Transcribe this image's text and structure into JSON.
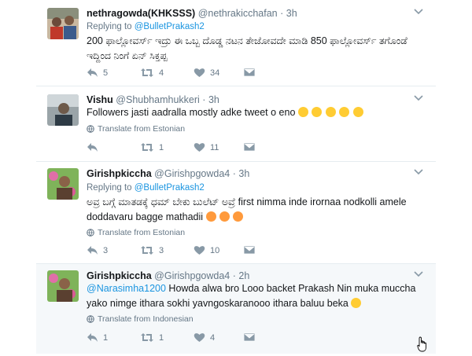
{
  "tweets": [
    {
      "name": "nethragowda(KHKSSS)",
      "handle": "@nethrakicchafan",
      "time": "3h",
      "reply_prefix": "Replying to",
      "reply_to": "@BulletPrakash2",
      "text_line1": "200 ಫಾಲ್ಲೋವರ್ಸ್ ಇದ್ರು ಈ ಒಬ್ಬ ದೊಡ್ಡ ನಟನ ತೇಜೋವದೇ ಮಾಡಿ 850 ಫಾಲ್ಲೋವರ್ಸ್ ತಗೊಂಡೆ",
      "text_line2": "ಇದ್ದಿಂದ ನಿಂಗೆ ಏನ್ ಸಿಕ್ತಪ್ಪ",
      "replies": "5",
      "retweets": "4",
      "likes": "34"
    },
    {
      "name": "Vishu",
      "handle": "@Shubhamhukkeri",
      "time": "3h",
      "text": "Followers jasti aadralla mostly adke tweet o eno",
      "translate": "Translate from Estonian",
      "replies": "",
      "retweets": "1",
      "likes": "11"
    },
    {
      "name": "Girishpkiccha",
      "handle": "@Girishpgowda4",
      "time": "3h",
      "reply_prefix": "Replying to",
      "reply_to": "@BulletPrakash2",
      "text_line1": "ಅವ್ರ ಬಗ್ಗೆ ಮಾತಡಕ್ಕೆ ಧಮ್ ಬೇಕು ಬುಲೆಟ್ ಅವ್ರೆ first nimma inde irornaa nodkolli amele",
      "text_line2": "doddavaru bagge mathadii",
      "translate": "Translate from Estonian",
      "replies": "3",
      "retweets": "3",
      "likes": "10"
    },
    {
      "name": "Girishpkiccha",
      "handle": "@Girishpgowda4",
      "time": "2h",
      "mention": "@Narasimha1200",
      "text_line1": " Howda alwa bro Looo backet Prakash Nin muka muccha",
      "text_line2": "yako nimge ithara sokhi yavngoskaranooo ithara baluu beka",
      "translate": "Translate from Indonesian",
      "replies": "1",
      "retweets": "1",
      "likes": "4"
    }
  ],
  "icons": {
    "reply": "reply-icon",
    "retweet": "retweet-icon",
    "like": "heart-icon",
    "dm": "envelope-icon",
    "globe": "globe-icon",
    "caret": "chevron-down-icon"
  },
  "colors": {
    "link": "#1b95e0",
    "muted": "#657786",
    "highlight_bg": "#f5f8fa",
    "border": "#e6ecf0"
  }
}
